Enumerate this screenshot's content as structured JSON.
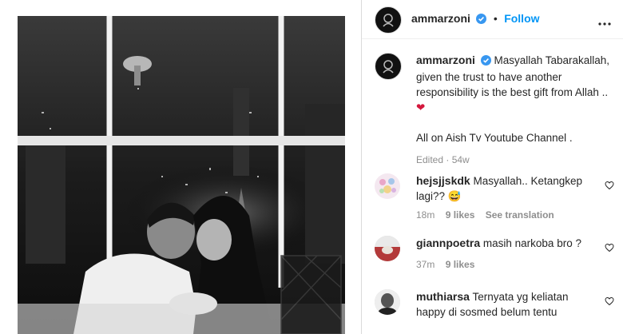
{
  "post": {
    "username": "ammarzoni",
    "follow_label": "Follow",
    "separator": "•"
  },
  "caption": {
    "username": "ammarzoni",
    "text": "Masyallah Tabarakallah, given the trust to have another responsibility is the best gift from Allah ..",
    "emoji": "❤",
    "text2": "All on Aish Tv Youtube Channel .",
    "meta": "Edited · 54w"
  },
  "comments": [
    {
      "username": "hejsjjskdk",
      "text": "Masyallah.. Ketangkep lagi?? 😅",
      "time": "18m",
      "likes": "9 likes",
      "translate": "See translation"
    },
    {
      "username": "giannpoetra",
      "text": "masih narkoba bro ?",
      "time": "37m",
      "likes": "9 likes"
    },
    {
      "username": "muthiarsa",
      "text": "Ternyata yg keliatan happy di sosmed belum tentu"
    }
  ],
  "colors": {
    "accent": "#0095f6",
    "verified": "#3897f0",
    "meta": "#8e8e8e",
    "heart": "#d4183d"
  },
  "icons": [
    "verified-badge-icon",
    "more-options-icon",
    "heart-icon",
    "heart-emoji-icon"
  ]
}
